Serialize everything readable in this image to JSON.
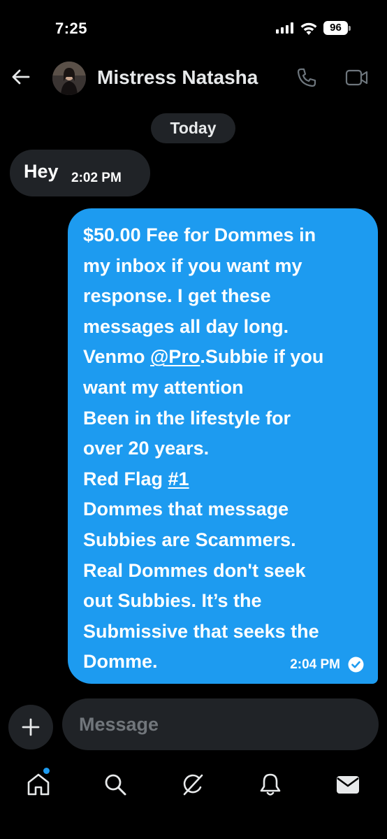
{
  "status_bar": {
    "time": "7:25",
    "battery": "96"
  },
  "header": {
    "contact_name": "Mistress Natasha"
  },
  "conversation": {
    "date_divider": "Today",
    "messages": [
      {
        "direction": "received",
        "text": "Hey",
        "time": "2:02 PM"
      },
      {
        "direction": "sent",
        "lines": [
          "$50.00 Fee for Dommes in",
          "my inbox if you want my",
          "response. I get these",
          "messages all day long.",
          "Venmo @Pro.Subbie if you",
          "want my attention",
          "Been in the lifestyle for",
          "over 20 years.",
          "Red Flag #1",
          "Dommes that message",
          "Subbies are Scammers.",
          "Real Dommes don't seek",
          "out Subbies. It’s the",
          "Submissive that seeks the",
          "Domme."
        ],
        "mention": "@Pro",
        "hashtag": "#1",
        "time": "2:04 PM",
        "status": "read"
      }
    ]
  },
  "composer": {
    "placeholder": "Message"
  },
  "nav": {
    "items": [
      "home-icon",
      "search-icon",
      "grok-icon",
      "notifications-icon",
      "messages-icon"
    ],
    "home_has_notification_dot": true
  },
  "colors": {
    "accent": "#1d9bf0",
    "background": "#000000",
    "bubble_received": "#202327"
  }
}
